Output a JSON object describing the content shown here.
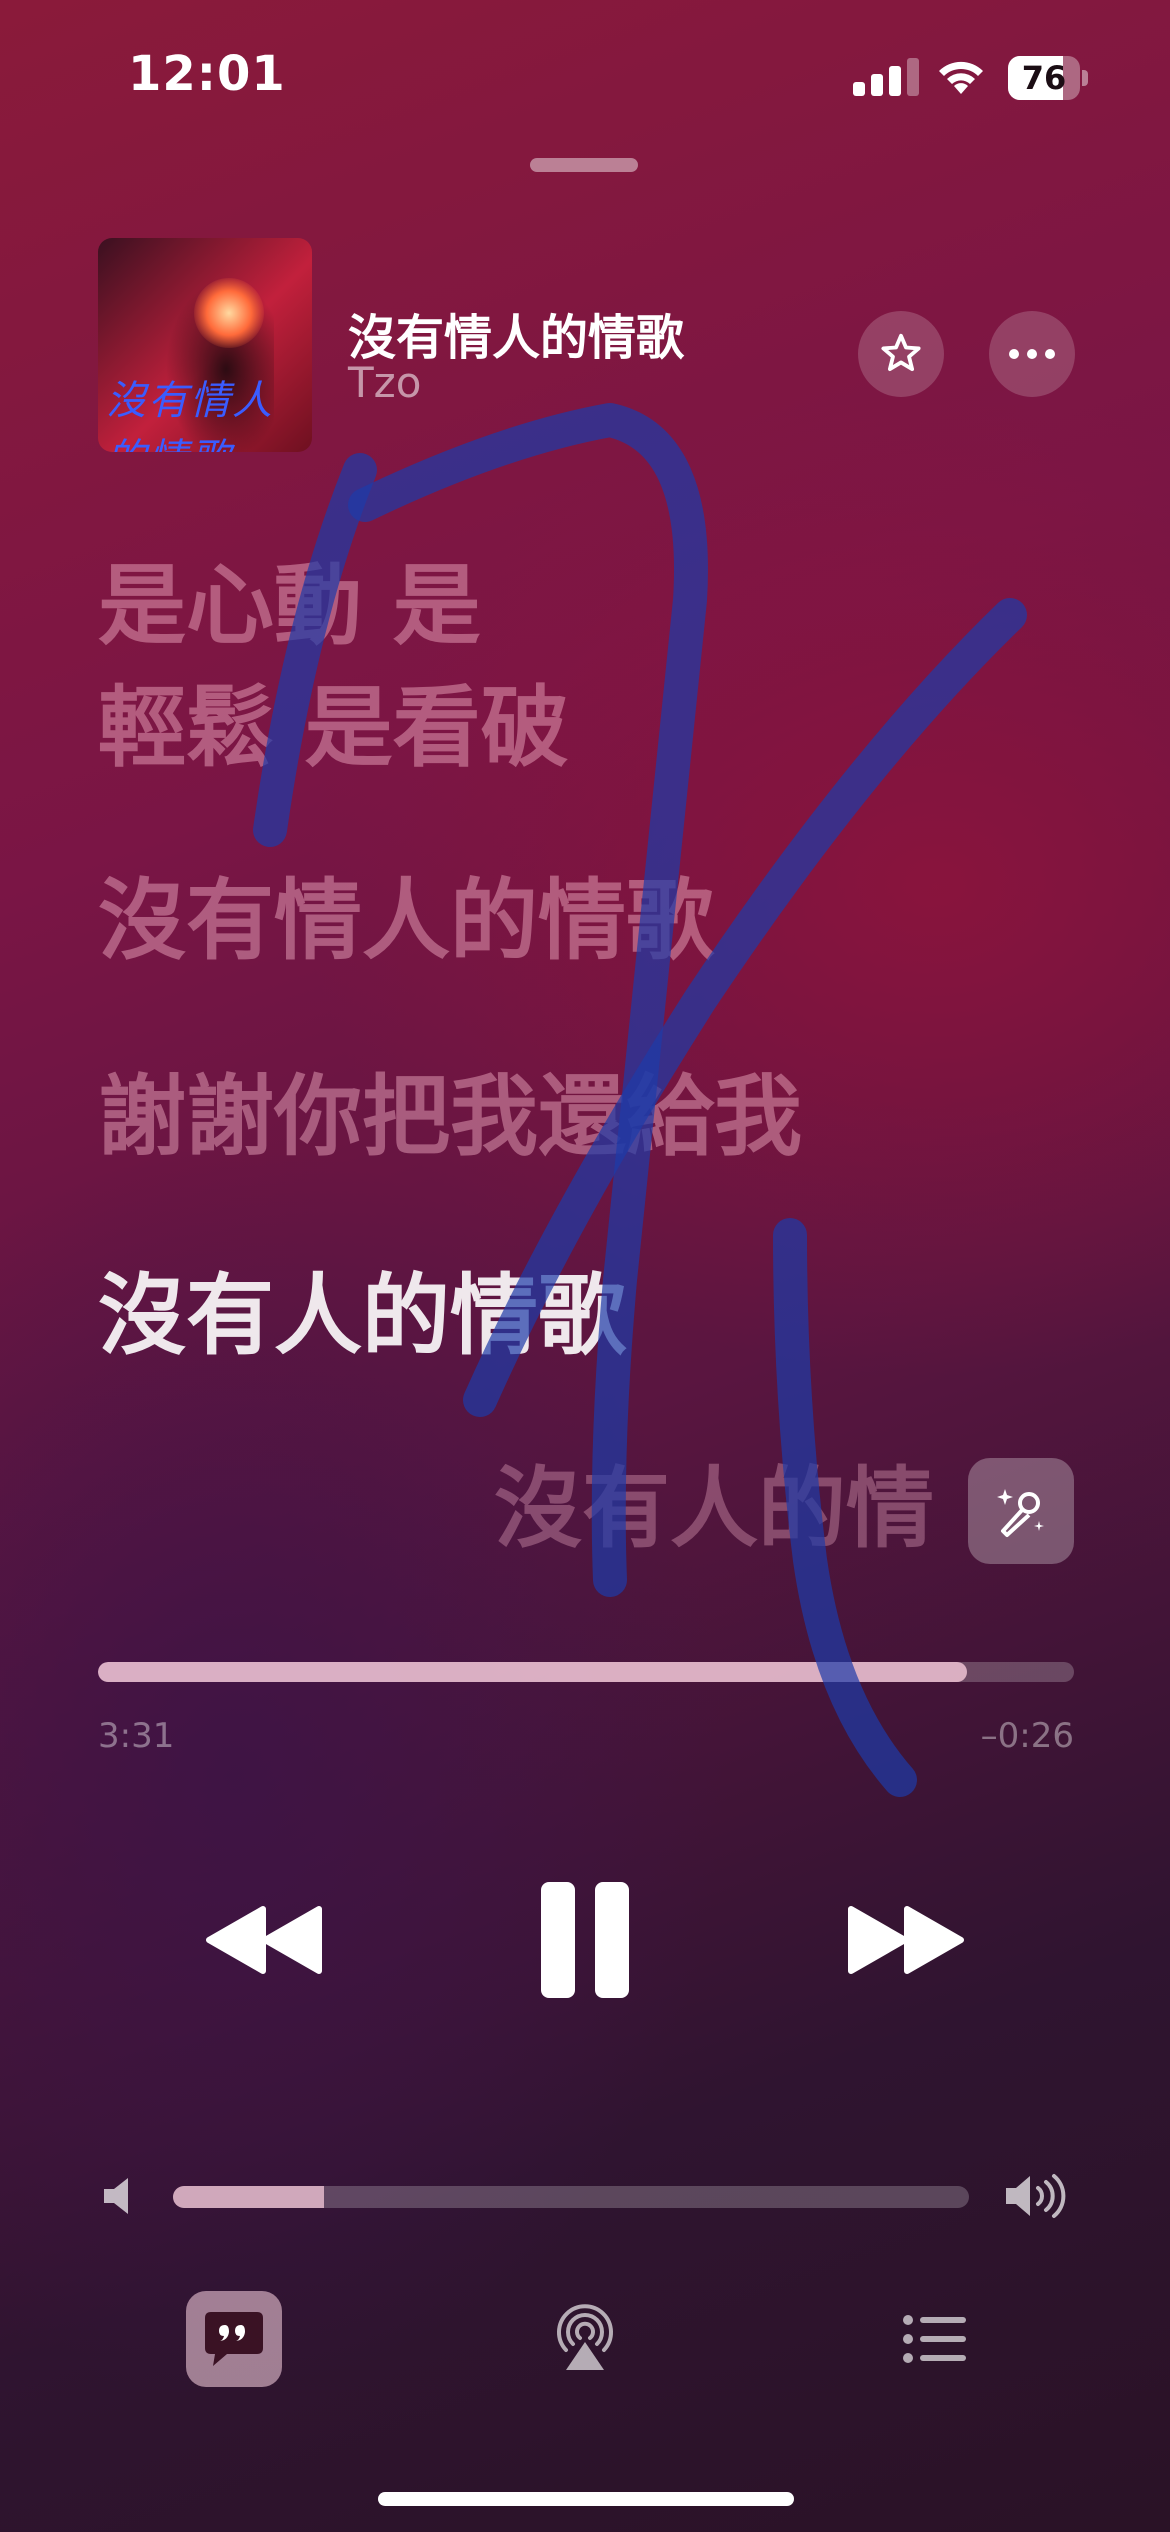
{
  "status_bar": {
    "time": "12:01",
    "signal_bars_active": 3,
    "signal_bars_total": 4,
    "battery_level": "76",
    "battery_fraction": 0.76
  },
  "now_playing": {
    "title": "沒有情人的情歌",
    "artist": "Tzo",
    "artwork_script": "沒有情人的情歌"
  },
  "lyrics": [
    "是心動 是",
    "輕鬆 是看破",
    "沒有情人的情歌",
    "謝謝你把我還給我",
    "沒有人的情歌",
    "沒有人的情"
  ],
  "active_lyric_index": 4,
  "progress": {
    "elapsed": "3:31",
    "remaining": "–0:26",
    "fraction": 0.89
  },
  "volume": {
    "fraction": 0.19
  },
  "icons": {
    "star": "star-icon",
    "more": "ellipsis-icon",
    "sing": "microphone-sparkle-icon",
    "prev": "backward-icon",
    "pause": "pause-icon",
    "next": "forward-icon",
    "vol_low": "speaker-low-icon",
    "vol_high": "speaker-high-icon",
    "lyrics": "lyrics-bubble-icon",
    "airplay": "airplay-icon",
    "queue": "list-icon"
  },
  "colors": {
    "background_top": "#8a1a3a",
    "background_bottom": "#2a1226",
    "scribble": "#1e3aa8"
  }
}
